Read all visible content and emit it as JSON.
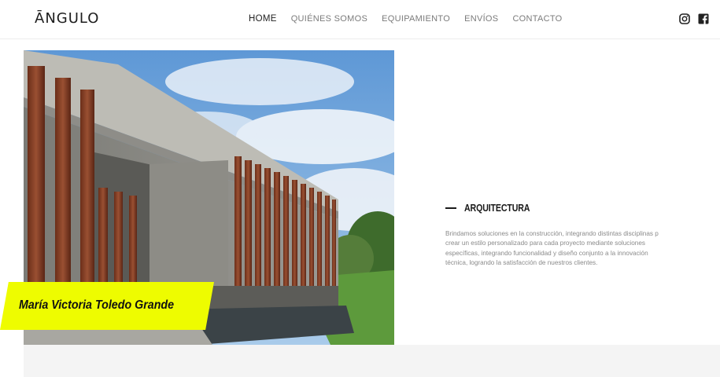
{
  "header": {
    "logo": "ĀNGULO",
    "nav": [
      {
        "label": "HOME",
        "active": true
      },
      {
        "label": "QUIÉNES SOMOS",
        "active": false
      },
      {
        "label": "EQUIPAMIENTO",
        "active": false
      },
      {
        "label": "ENVÍOS",
        "active": false
      },
      {
        "label": "CONTACTO",
        "active": false
      }
    ],
    "social": [
      "instagram-icon",
      "facebook-icon"
    ]
  },
  "section": {
    "title": "ARQUITECTURA",
    "description_lines": [
      "Brindamos soluciones en la construcción, integrando distintas disciplinas p",
      "crear un estilo personalizado para cada proyecto mediante soluciones",
      "específicas, integrando funcionalidad y diseño conjunto a la innovación",
      "técnica, logrando la satisfacción de nuestros clientes."
    ]
  },
  "name_tag": {
    "text": "María Victoria Toledo Grande",
    "color": "#eefc00"
  },
  "colors": {
    "accent": "#eefc00",
    "text_dark": "#1a1a1a",
    "text_muted": "#8a8a8a",
    "band": "#f4f4f4"
  }
}
